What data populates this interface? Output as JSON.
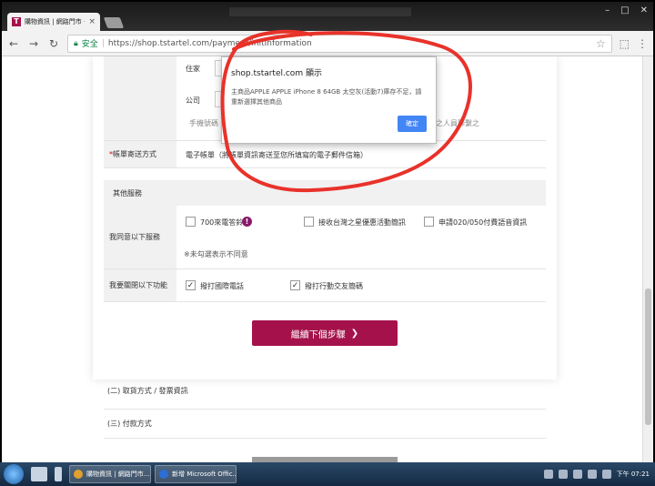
{
  "browser": {
    "tab_title": "購物資訊 | 網路門市 - 台",
    "tab_close": "×",
    "secure_label": "安全",
    "url": "https://shop.tstartel.com/payment/initInformation",
    "favicon_letter": "T"
  },
  "form": {
    "home_label": "住家",
    "office_label": "公司",
    "phone_hint": "手機號碼",
    "contact_suffix": "之人員聯繫之",
    "bill_label": "帳單寄送方式",
    "bill_value": "電子帳單（將帳單資訊寄送至您所填寫的電子郵件信箱）"
  },
  "other_services": {
    "title": "其他服務",
    "agree_label": "我同意以下服務",
    "options": [
      "700來電答鈴",
      "接收台灣之星優惠活動簡訊",
      "申請020/050付費語音資訊"
    ],
    "note": "※未勾選表示不同意",
    "enable_label": "我要關閉以下功能",
    "enable_options": [
      "撥打國際電話",
      "撥打行動交友簡碼"
    ],
    "checked_mark": "✓"
  },
  "next_button": {
    "label": "繼續下個步驟",
    "arrow": "❯"
  },
  "steps": [
    "(二) 取貨方式 / 發票資訊",
    "(三) 付款方式"
  ],
  "dialog": {
    "title": "shop.tstartel.com 顯示",
    "message": "主商品APPLE APPLE iPhone 8 64GB 太空灰(活動7)庫存不足，請重新選擇其他商品",
    "ok": "確定"
  },
  "taskbar": {
    "tasks": [
      "購物資訊 | 網路門市...",
      "新增 Microsoft Offic..."
    ],
    "clock": "下午 07:21"
  },
  "colors": {
    "brand": "#a5124b",
    "annotation": "#e8322a",
    "dialog_button": "#4285f4"
  }
}
